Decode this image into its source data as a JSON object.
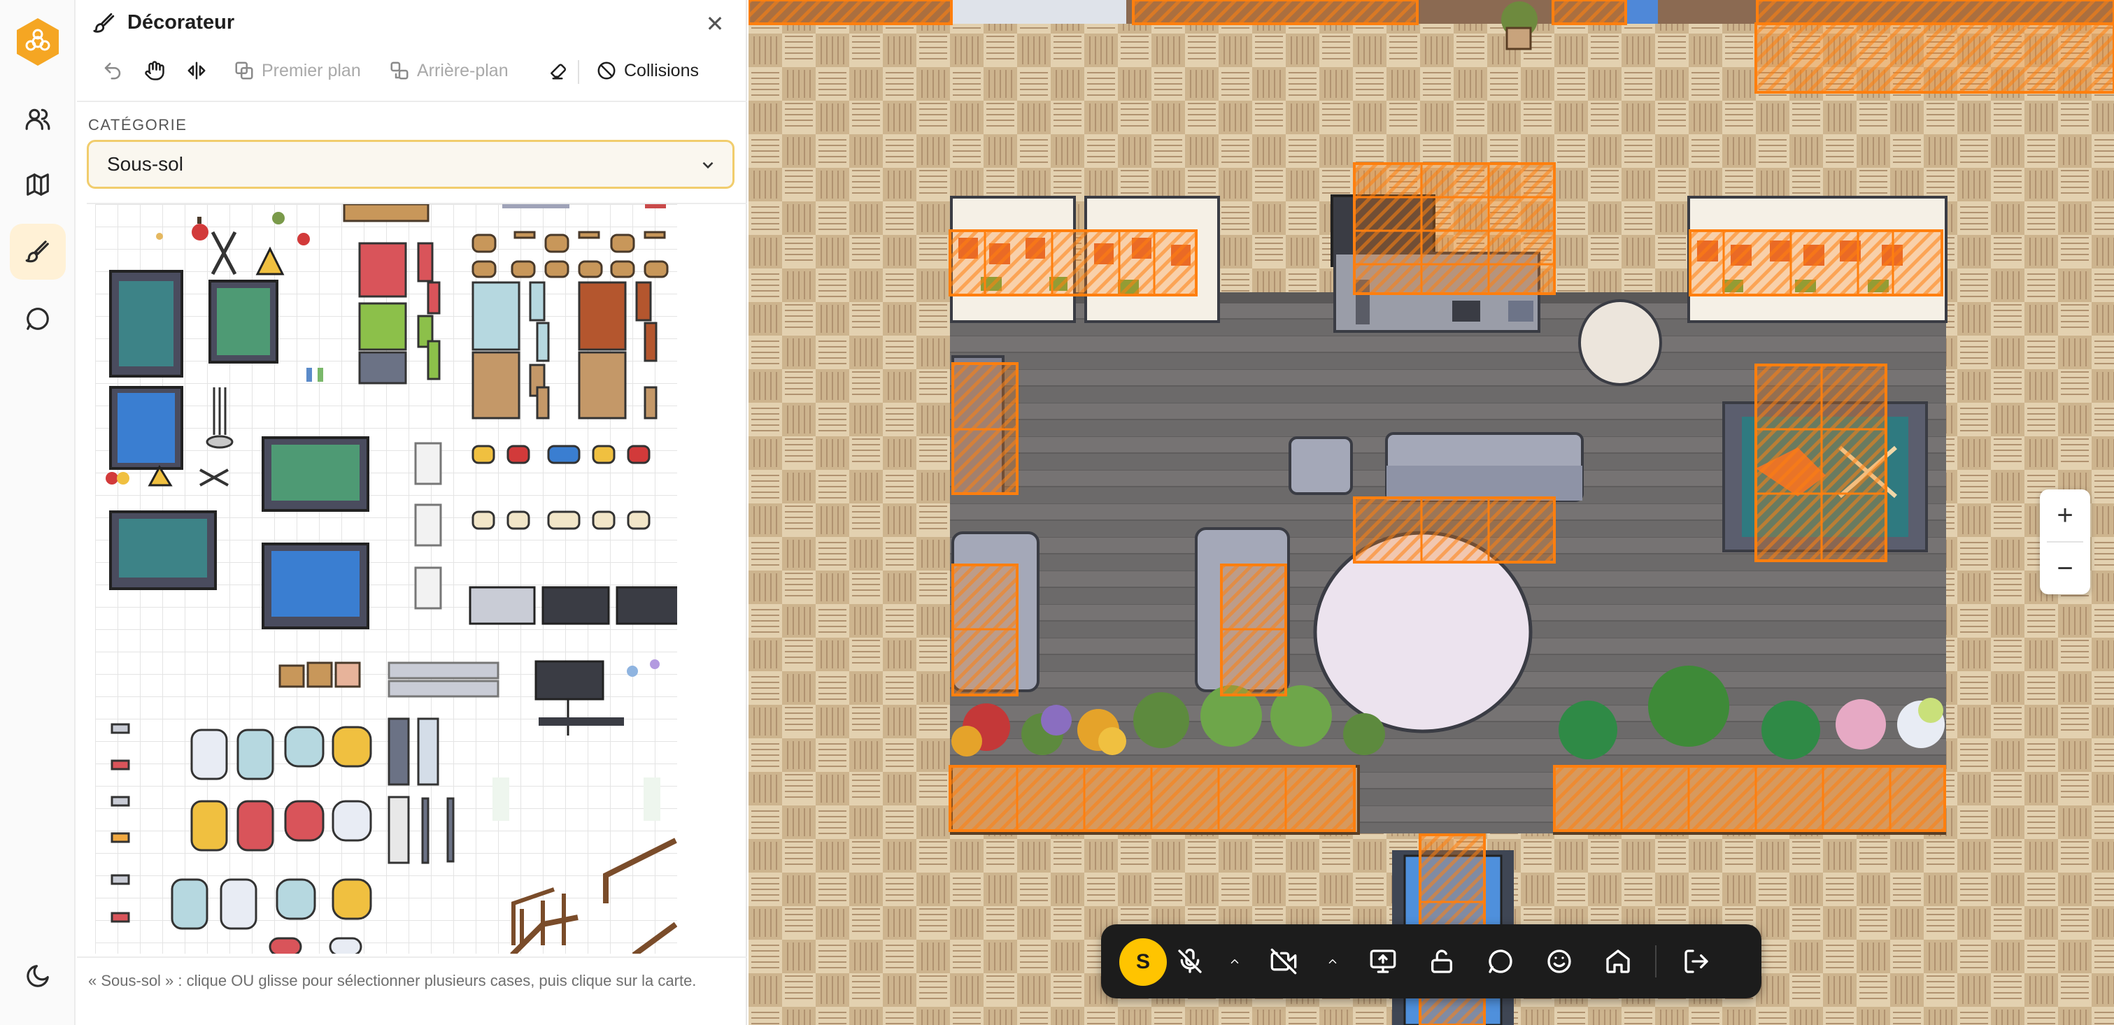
{
  "rail": {
    "logo_icon": "hexagon-flower-logo",
    "items": [
      {
        "name": "people",
        "icon": "users-icon"
      },
      {
        "name": "map",
        "icon": "map-icon"
      },
      {
        "name": "decorator",
        "icon": "brush-icon",
        "active": true
      },
      {
        "name": "chat",
        "icon": "chat-bubble-icon"
      }
    ],
    "bottom_icon": "moon-icon"
  },
  "panel": {
    "title": "Décorateur",
    "toolbar": {
      "undo": "",
      "foreground": "Premier plan",
      "background": "Arrière-plan",
      "collisions": "Collisions"
    },
    "category_label": "CATÉGORIE",
    "category_value": "Sous-sol",
    "footer_hint": "« Sous-sol » : clique OU glisse pour sélectionner plusieurs cases, puis clique sur la carte."
  },
  "map": {
    "zoom_in": "+",
    "zoom_out": "−"
  },
  "control_bar": {
    "avatar_initial": "S",
    "buttons": [
      "mic-off-icon",
      "chevron-up-icon",
      "camera-off-icon",
      "chevron-up-icon",
      "screen-share-icon",
      "lock-open-icon",
      "chat-bubble-icon",
      "emoji-icon",
      "home-icon",
      "exit-icon"
    ]
  },
  "colors": {
    "accent": "#f5a623",
    "collision_overlay": "#ff7f0e",
    "floor_light": "#d8c6a3",
    "floor_dark": "#6d6b6b",
    "control_bar": "#1c1c1c"
  }
}
